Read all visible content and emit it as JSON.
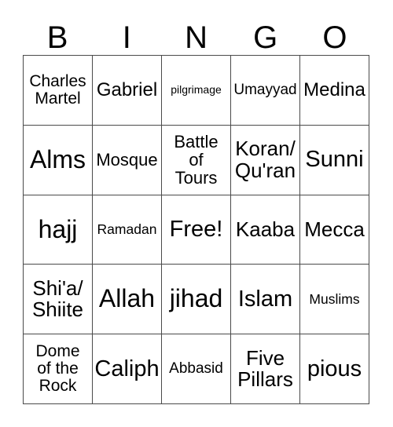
{
  "card": {
    "title": "BINGO",
    "header_letters": [
      "B",
      "I",
      "N",
      "G",
      "O"
    ],
    "free_space_label": "Free!",
    "grid_size": "5x5",
    "colors": {
      "background": "#ffffff",
      "border": "#4a4a4a",
      "text": "#000000"
    },
    "rows": [
      [
        {
          "text": "Charles\nMartel",
          "size": "s"
        },
        {
          "text": "Gabriel",
          "size": "m"
        },
        {
          "text": "pilgrimage",
          "size": "tiny"
        },
        {
          "text": "Umayyad",
          "size": "xs"
        },
        {
          "text": "Medina",
          "size": "m"
        }
      ],
      [
        {
          "text": "Alms",
          "size": "xxl"
        },
        {
          "text": "Mosque",
          "size": "ml"
        },
        {
          "text": "Battle\nof\nTours",
          "size": "ml"
        },
        {
          "text": "Koran/\nQu'ran",
          "size": "l"
        },
        {
          "text": "Sunni",
          "size": "xl"
        }
      ],
      [
        {
          "text": "hajj",
          "size": "xxl"
        },
        {
          "text": "Ramadan",
          "size": "xxs"
        },
        {
          "text": "Free!",
          "size": "xl"
        },
        {
          "text": "Kaaba",
          "size": "l"
        },
        {
          "text": "Mecca",
          "size": "l"
        }
      ],
      [
        {
          "text": "Shi'a/\nShiite",
          "size": "l"
        },
        {
          "text": "Allah",
          "size": "xxl"
        },
        {
          "text": "jihad",
          "size": "xxl"
        },
        {
          "text": "Islam",
          "size": "xl"
        },
        {
          "text": "Muslims",
          "size": "xxs"
        }
      ],
      [
        {
          "text": "Dome\nof the\nRock",
          "size": "s"
        },
        {
          "text": "Caliph",
          "size": "xl"
        },
        {
          "text": "Abbasid",
          "size": "xs"
        },
        {
          "text": "Five\nPillars",
          "size": "l"
        },
        {
          "text": "pious",
          "size": "xl"
        }
      ]
    ]
  }
}
